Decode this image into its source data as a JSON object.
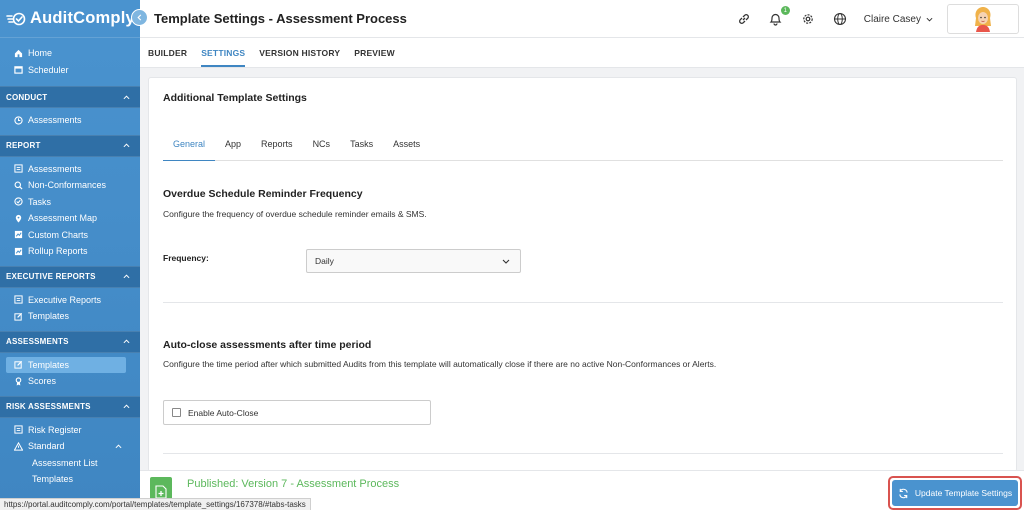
{
  "app": {
    "name": "AuditComply"
  },
  "header": {
    "title": "Template Settings - Assessment Process",
    "notification_count": "1",
    "user_name": "Claire Casey"
  },
  "sidebar": {
    "top_items": [
      {
        "label": "Home",
        "icon": "home-icon"
      },
      {
        "label": "Scheduler",
        "icon": "calendar-icon"
      }
    ],
    "sections": [
      {
        "title": "CONDUCT",
        "items": [
          {
            "label": "Assessments",
            "icon": "clock-icon"
          }
        ]
      },
      {
        "title": "REPORT",
        "items": [
          {
            "label": "Assessments",
            "icon": "list-icon"
          },
          {
            "label": "Non-Conformances",
            "icon": "search-icon"
          },
          {
            "label": "Tasks",
            "icon": "check-circle-icon"
          },
          {
            "label": "Assessment Map",
            "icon": "map-pin-icon"
          },
          {
            "label": "Custom Charts",
            "icon": "chart-icon"
          },
          {
            "label": "Rollup Reports",
            "icon": "chart-icon"
          }
        ]
      },
      {
        "title": "EXECUTIVE REPORTS",
        "items": [
          {
            "label": "Executive Reports",
            "icon": "list-icon"
          },
          {
            "label": "Templates",
            "icon": "edit-icon"
          }
        ]
      },
      {
        "title": "ASSESSMENTS",
        "items": [
          {
            "label": "Templates",
            "icon": "edit-icon"
          },
          {
            "label": "Scores",
            "icon": "award-icon"
          }
        ]
      },
      {
        "title": "RISK ASSESSMENTS",
        "items": [
          {
            "label": "Risk Register",
            "icon": "list-icon"
          },
          {
            "label": "Standard",
            "icon": "warning-icon"
          },
          {
            "label": "Assessment List",
            "icon": ""
          },
          {
            "label": "Templates",
            "icon": ""
          }
        ]
      }
    ]
  },
  "subnav": {
    "tabs": [
      "BUILDER",
      "SETTINGS",
      "VERSION HISTORY",
      "PREVIEW"
    ],
    "active": "SETTINGS"
  },
  "card": {
    "title": "Additional Template Settings",
    "tabs": [
      "General",
      "App",
      "Reports",
      "NCs",
      "Tasks",
      "Assets"
    ],
    "active_tab": "General",
    "overdue": {
      "title": "Overdue Schedule Reminder Frequency",
      "description": "Configure the frequency of overdue schedule reminder emails & SMS.",
      "frequency_label": "Frequency:",
      "frequency_value": "Daily"
    },
    "autoclose": {
      "title": "Auto-close assessments after time period",
      "description": "Configure the time period after which submitted Audits from this template will automatically close if there are no active Non-Conformances or Alerts.",
      "checkbox_label": "Enable Auto-Close",
      "checked": false
    }
  },
  "bottom": {
    "published_text": "Published: Version 7 - Assessment Process",
    "update_button": "Update Template Settings"
  },
  "status_url": "https://portal.auditcomply.com/portal/templates/template_settings/167378/#tabs-tasks",
  "colors": {
    "brand": "#3f86c2",
    "published": "#5cb85c",
    "highlight": "#d9534f"
  }
}
